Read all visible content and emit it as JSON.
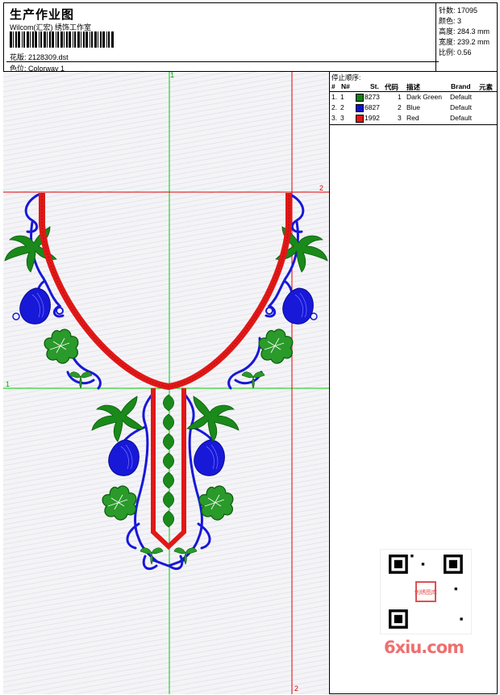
{
  "header": {
    "title": "生产作业图",
    "company": "Wilcom(汇宏) 绣饰工作室",
    "design_label": "花版:",
    "design_value": "2128309.dst",
    "colorway_label": "色位:",
    "colorway_value": "Colorway 1"
  },
  "stats": [
    {
      "label": "针数:",
      "value": "17095"
    },
    {
      "label": "颜色:",
      "value": "3"
    },
    {
      "label": "高度:",
      "value": "284.3 mm"
    },
    {
      "label": "宽度:",
      "value": "239.2 mm"
    },
    {
      "label": "比例:",
      "value": "0.56"
    }
  ],
  "stop_sequence": {
    "title": "停止顺序:",
    "headers": {
      "num": "#",
      "n": "N#",
      "st": "St.",
      "code": "代码",
      "desc": "描述",
      "brand": "Brand",
      "elements": "元素"
    },
    "rows": [
      {
        "num": "1.",
        "n": "1",
        "color": "#108010",
        "st": "8273",
        "code": "1",
        "desc": "Dark Green",
        "brand": "Default"
      },
      {
        "num": "2.",
        "n": "2",
        "color": "#1010d0",
        "st": "6827",
        "code": "2",
        "desc": "Blue",
        "brand": "Default"
      },
      {
        "num": "3.",
        "n": "3",
        "color": "#e01818",
        "st": "1992",
        "code": "3",
        "desc": "Red",
        "brand": "Default"
      }
    ]
  },
  "guides": {
    "v1_label": "1",
    "h1_label": "1",
    "h2_label": "2",
    "v2_label": "2",
    "green": "#00cc00",
    "red": "#e00000"
  },
  "colors": {
    "green": "#108010",
    "blue": "#1010d0",
    "red": "#e01818"
  },
  "watermark": "6xiu.com",
  "qr_stamp": "刺绣图库"
}
